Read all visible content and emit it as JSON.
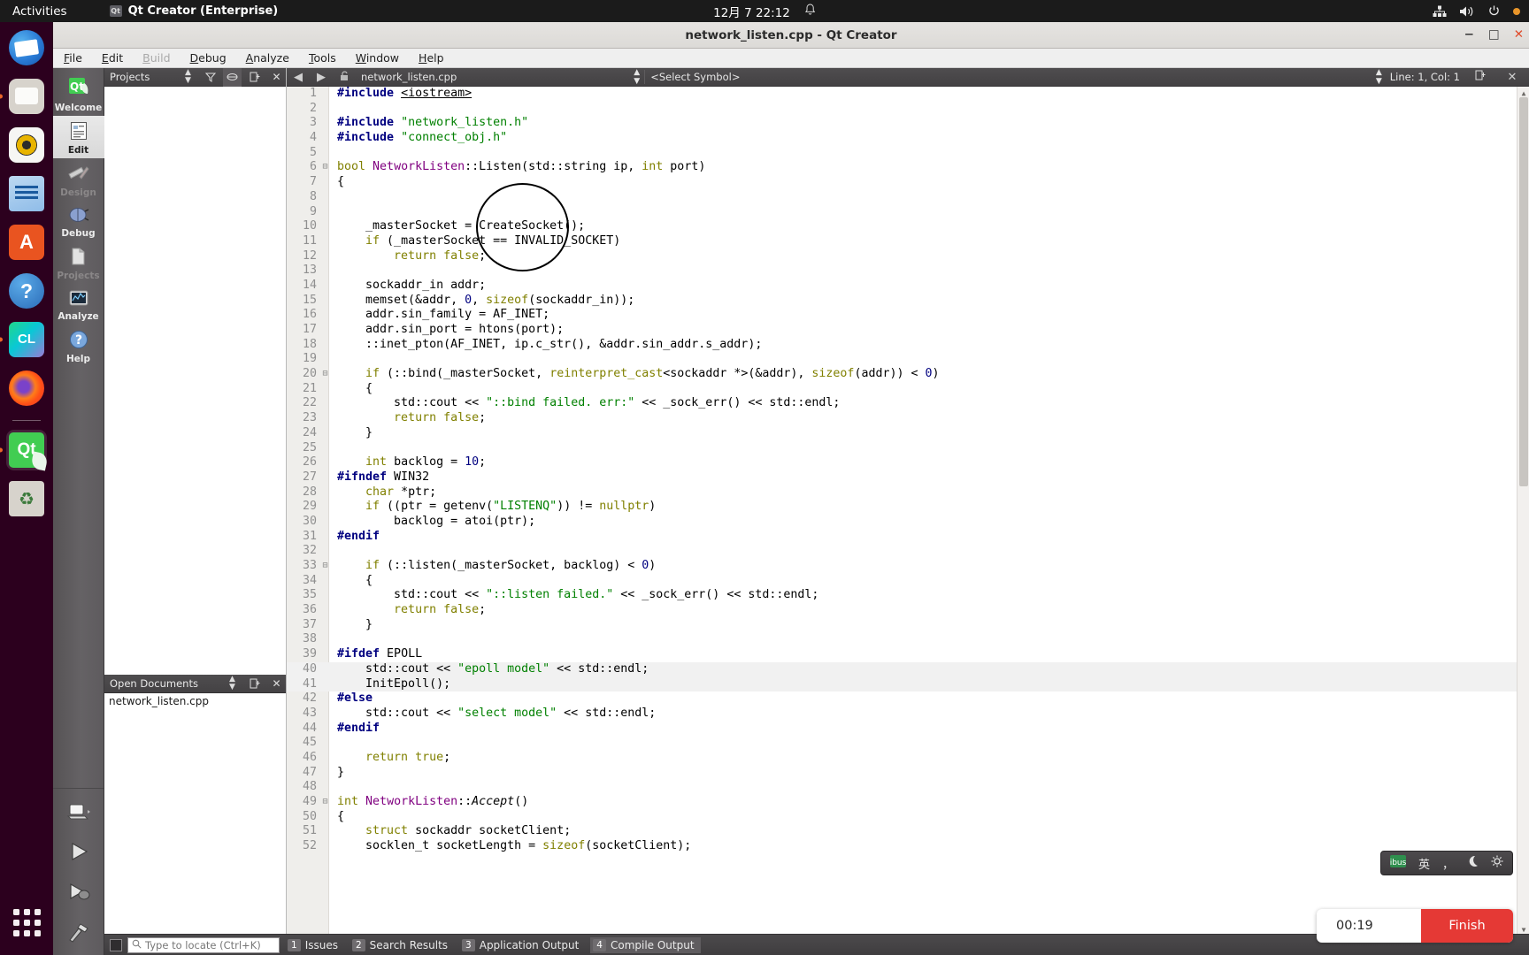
{
  "desktop": {
    "activities_label": "Activities",
    "app_name": "Qt Creator (Enterprise)",
    "clock": "12月 7  22:12",
    "tray_icons": [
      "network-icon",
      "volume-icon",
      "power-icon"
    ],
    "dock_items": [
      {
        "name": "thunderbird",
        "label": "Thunderbird Mail",
        "running": false
      },
      {
        "name": "files",
        "label": "Files",
        "running": true
      },
      {
        "name": "rhythmbox",
        "label": "Rhythmbox",
        "running": false
      },
      {
        "name": "writer",
        "label": "LibreOffice Writer",
        "running": false
      },
      {
        "name": "software",
        "label": "Ubuntu Software",
        "running": false,
        "glyph": "A"
      },
      {
        "name": "help",
        "label": "Help",
        "running": false,
        "glyph": "?"
      },
      {
        "name": "clion",
        "label": "CLion",
        "running": true,
        "glyph": "CL"
      },
      {
        "name": "firefox",
        "label": "Firefox",
        "running": false
      },
      {
        "name": "qtcreator",
        "label": "Qt Creator",
        "running": true,
        "active": true,
        "glyph": "Qt"
      },
      {
        "name": "trash",
        "label": "Trash",
        "running": false
      }
    ],
    "show_apps_label": "Show Applications"
  },
  "window": {
    "title": "network_listen.cpp - Qt Creator",
    "minimize": "−",
    "maximize": "□",
    "close": "✕"
  },
  "menubar": [
    {
      "label": "File",
      "disabled": false
    },
    {
      "label": "Edit",
      "disabled": false
    },
    {
      "label": "Build",
      "disabled": true
    },
    {
      "label": "Debug",
      "disabled": false
    },
    {
      "label": "Analyze",
      "disabled": false
    },
    {
      "label": "Tools",
      "disabled": false
    },
    {
      "label": "Window",
      "disabled": false
    },
    {
      "label": "Help",
      "disabled": false
    }
  ],
  "modes": [
    {
      "label": "Welcome",
      "state": "normal"
    },
    {
      "label": "Edit",
      "state": "selected"
    },
    {
      "label": "Design",
      "state": "disabled"
    },
    {
      "label": "Debug",
      "state": "normal"
    },
    {
      "label": "Projects",
      "state": "disabled"
    },
    {
      "label": "Analyze",
      "state": "normal"
    },
    {
      "label": "Help",
      "state": "normal"
    }
  ],
  "mode_buttons": [
    {
      "name": "kit-selector",
      "label": "Kit Selector"
    },
    {
      "name": "run-button",
      "label": "Run"
    },
    {
      "name": "debug-button",
      "label": "Start Debugging"
    },
    {
      "name": "build-button",
      "label": "Build Project"
    }
  ],
  "sidebar": {
    "projects_title": "Projects",
    "opendocs_title": "Open Documents",
    "open_documents": [
      "network_listen.cpp"
    ],
    "header_buttons": [
      "filter-icon",
      "sync-icon",
      "split-icon",
      "close-icon"
    ]
  },
  "editor_toolbar": {
    "back_icon": "back-arrow-icon",
    "forward_icon": "forward-arrow-icon",
    "lock_icon": "unlocked-icon",
    "filename": "network_listen.cpp",
    "symbol_placeholder": "<Select Symbol>",
    "cursor_position": "Line: 1, Col: 1",
    "split_icon": "split-editor-icon",
    "close_icon": "close-editor-icon"
  },
  "code": {
    "language": "cpp",
    "highlighted_lines": [
      40,
      41
    ],
    "fold_markers": [
      6,
      20,
      33,
      49
    ],
    "lines": [
      {
        "n": 1,
        "html": "<span class=\"pre\">#include</span> <span class=\"incw\">&lt;iostream&gt;</span>"
      },
      {
        "n": 2,
        "html": ""
      },
      {
        "n": 3,
        "html": "<span class=\"pre\">#include</span> <span class=\"str\">\"network_listen.h\"</span>"
      },
      {
        "n": 4,
        "html": "<span class=\"pre\">#include</span> <span class=\"str\">\"connect_obj.h\"</span>"
      },
      {
        "n": 5,
        "html": ""
      },
      {
        "n": 6,
        "html": "<span class=\"kw\">bool</span> <span class=\"cls\">NetworkListen</span>::Listen(std::string ip, <span class=\"kw\">int</span> port)"
      },
      {
        "n": 7,
        "html": "{"
      },
      {
        "n": 8,
        "html": ""
      },
      {
        "n": 9,
        "html": ""
      },
      {
        "n": 10,
        "html": "    _masterSocket = CreateSocket();"
      },
      {
        "n": 11,
        "html": "    <span class=\"kw\">if</span> (_masterSocket == INVALID_SOCKET)"
      },
      {
        "n": 12,
        "html": "        <span class=\"kw\">return</span> <span class=\"kw\">false</span>;"
      },
      {
        "n": 13,
        "html": ""
      },
      {
        "n": 14,
        "html": "    sockaddr_in addr;"
      },
      {
        "n": 15,
        "html": "    memset(&amp;addr, <span class=\"num\">0</span>, <span class=\"kw\">sizeof</span>(sockaddr_in));"
      },
      {
        "n": 16,
        "html": "    addr.sin_family = AF_INET;"
      },
      {
        "n": 17,
        "html": "    addr.sin_port = htons(port);"
      },
      {
        "n": 18,
        "html": "    ::inet_pton(AF_INET, ip.c_str(), &amp;addr.sin_addr.s_addr);"
      },
      {
        "n": 19,
        "html": ""
      },
      {
        "n": 20,
        "html": "    <span class=\"kw\">if</span> (::bind(_masterSocket, <span class=\"kw\">reinterpret_cast</span>&lt;sockaddr *&gt;(&amp;addr), <span class=\"kw\">sizeof</span>(addr)) &lt; <span class=\"num\">0</span>)"
      },
      {
        "n": 21,
        "html": "    {"
      },
      {
        "n": 22,
        "html": "        std::cout &lt;&lt; <span class=\"str\">\"::bind failed. err:\"</span> &lt;&lt; _sock_err() &lt;&lt; std::endl;"
      },
      {
        "n": 23,
        "html": "        <span class=\"kw\">return</span> <span class=\"kw\">false</span>;"
      },
      {
        "n": 24,
        "html": "    }"
      },
      {
        "n": 25,
        "html": ""
      },
      {
        "n": 26,
        "html": "    <span class=\"kw\">int</span> backlog = <span class=\"num\">10</span>;"
      },
      {
        "n": 27,
        "html": "<span class=\"pre\">#ifndef</span> WIN32"
      },
      {
        "n": 28,
        "html": "    <span class=\"kw\">char</span> *ptr;"
      },
      {
        "n": 29,
        "html": "    <span class=\"kw\">if</span> ((ptr = getenv(<span class=\"str\">\"LISTENQ\"</span>)) != <span class=\"kw\">nullptr</span>)"
      },
      {
        "n": 30,
        "html": "        backlog = atoi(ptr);"
      },
      {
        "n": 31,
        "html": "<span class=\"pre\">#endif</span>"
      },
      {
        "n": 32,
        "html": ""
      },
      {
        "n": 33,
        "html": "    <span class=\"kw\">if</span> (::listen(_masterSocket, backlog) &lt; <span class=\"num\">0</span>)"
      },
      {
        "n": 34,
        "html": "    {"
      },
      {
        "n": 35,
        "html": "        std::cout &lt;&lt; <span class=\"str\">\"::listen failed.\"</span> &lt;&lt; _sock_err() &lt;&lt; std::endl;"
      },
      {
        "n": 36,
        "html": "        <span class=\"kw\">return</span> <span class=\"kw\">false</span>;"
      },
      {
        "n": 37,
        "html": "    }"
      },
      {
        "n": 38,
        "html": ""
      },
      {
        "n": 39,
        "html": "<span class=\"pre\">#ifdef</span> EPOLL"
      },
      {
        "n": 40,
        "html": "    std::cout &lt;&lt; <span class=\"str\">\"epoll model\"</span> &lt;&lt; std::endl;"
      },
      {
        "n": 41,
        "html": "    InitEpoll();"
      },
      {
        "n": 42,
        "html": "<span class=\"pre\">#else</span>"
      },
      {
        "n": 43,
        "html": "    std::cout &lt;&lt; <span class=\"str\">\"select model\"</span> &lt;&lt; std::endl;"
      },
      {
        "n": 44,
        "html": "<span class=\"pre\">#endif</span>"
      },
      {
        "n": 45,
        "html": ""
      },
      {
        "n": 46,
        "html": "    <span class=\"kw\">return</span> <span class=\"kw\">true</span>;"
      },
      {
        "n": 47,
        "html": "}"
      },
      {
        "n": 48,
        "html": ""
      },
      {
        "n": 49,
        "html": "<span class=\"kw\">int</span> <span class=\"cls\">NetworkListen</span>::<span class=\"fn\">Accept</span>()"
      },
      {
        "n": 50,
        "html": "{"
      },
      {
        "n": 51,
        "html": "    <span class=\"kw\">struct</span> sockaddr socketClient;"
      },
      {
        "n": 52,
        "html": "    socklen_t socketLength = <span class=\"kw\">sizeof</span>(socketClient);"
      }
    ],
    "annotation": "hand-drawn-circle-around-CreateSocket"
  },
  "bottom_bar": {
    "sidebar_toggle": "toggle-sidebar-icon",
    "locator_placeholder": "Type to locate (Ctrl+K)",
    "locator_value": "",
    "output_tabs": [
      {
        "num": "1",
        "label": "Issues",
        "selected": false
      },
      {
        "num": "2",
        "label": "Search Results",
        "selected": false
      },
      {
        "num": "3",
        "label": "Application Output",
        "selected": false
      },
      {
        "num": "4",
        "label": "Compile Output",
        "selected": true
      }
    ]
  },
  "ime_panel": {
    "items": [
      "ime-logo-icon",
      "英",
      "，",
      "moon-icon",
      "gear-icon"
    ]
  },
  "recorder": {
    "time": "00:19",
    "finish_label": "Finish"
  }
}
